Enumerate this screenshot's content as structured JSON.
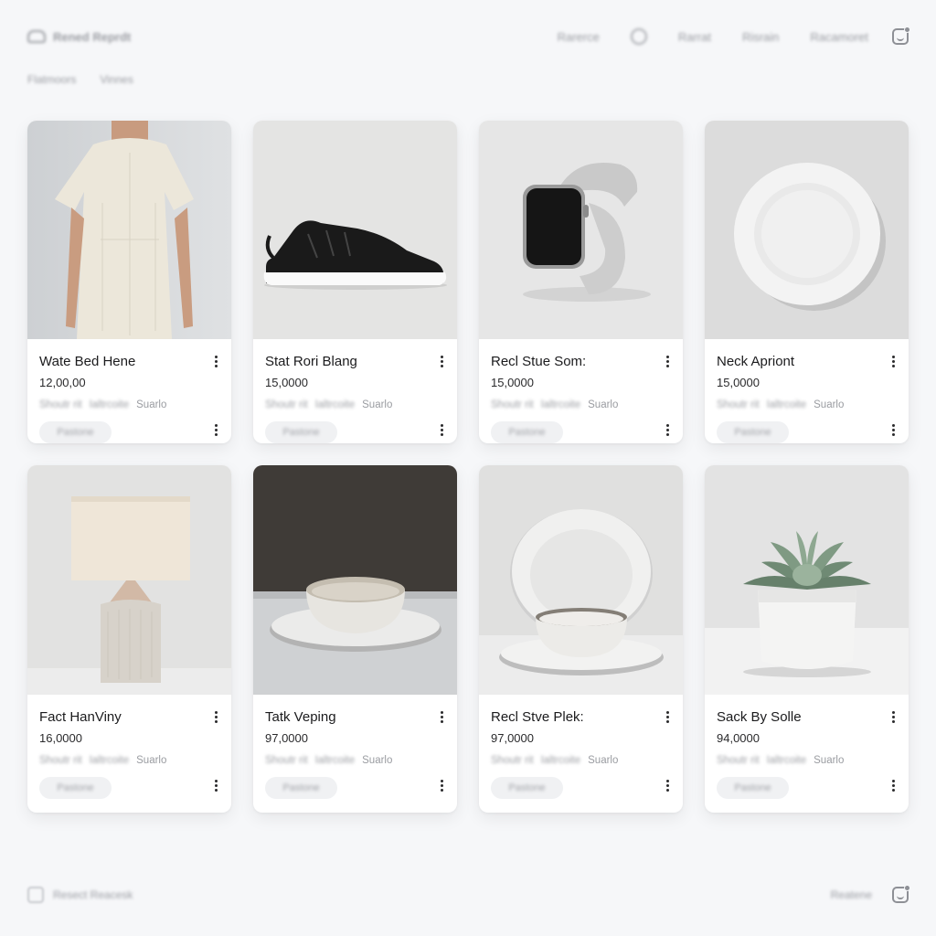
{
  "header": {
    "brand": "Rened Reprdt",
    "nav": [
      "Rarerce",
      "Rarrat",
      "Risrain",
      "Racamoret"
    ],
    "globe_icon": "globe-icon",
    "account_icon": "account-icon"
  },
  "subnav": [
    "Flatmoors",
    "Vinnes"
  ],
  "products": [
    {
      "title": "Wate Bed Hene",
      "price": "12,00,00",
      "meta1": "Shoutr rit",
      "meta2": "Ialtrcoite",
      "seller": "Suarlo",
      "pill": "Pastone",
      "image": "cream-dress"
    },
    {
      "title": "Stat Rori Blang",
      "price": "15,0000",
      "meta1": "Shoutr rit",
      "meta2": "Ialtrcoite",
      "seller": "Suarlo",
      "pill": "Pastone",
      "image": "black-sneaker"
    },
    {
      "title": "Recl Stue Som:",
      "price": "15,0000",
      "meta1": "Shoutr rit",
      "meta2": "Ialtrcoite",
      "seller": "Suarlo",
      "pill": "Pastone",
      "image": "smartwatch"
    },
    {
      "title": "Neck Apriont",
      "price": "15,0000",
      "meta1": "Shoutr rit",
      "meta2": "Ialtrcoite",
      "seller": "Suarlo",
      "pill": "Pastone",
      "image": "white-plate"
    },
    {
      "title": "Fact HanViny",
      "price": "16,0000",
      "meta1": "Shoutr rit",
      "meta2": "Ialtrcoite",
      "seller": "Suarlo",
      "pill": "Pastone",
      "image": "table-lamp"
    },
    {
      "title": "Tatk Veping",
      "price": "97,0000",
      "meta1": "Shoutr rit",
      "meta2": "Ialtrcoite",
      "seller": "Suarlo",
      "pill": "Pastone",
      "image": "bowl-dark"
    },
    {
      "title": "Recl Stve Plek:",
      "price": "97,0000",
      "meta1": "Shoutr rit",
      "meta2": "Ialtrcoite",
      "seller": "Suarlo",
      "pill": "Pastone",
      "image": "bowl-plates"
    },
    {
      "title": "Sack By Solle",
      "price": "94,0000",
      "meta1": "Shoutr rit",
      "meta2": "Ialtrcoite",
      "seller": "Suarlo",
      "pill": "Pastone",
      "image": "succulent"
    }
  ],
  "footer": {
    "brand": "Resect Reacesk",
    "right_link": "Reatene"
  }
}
